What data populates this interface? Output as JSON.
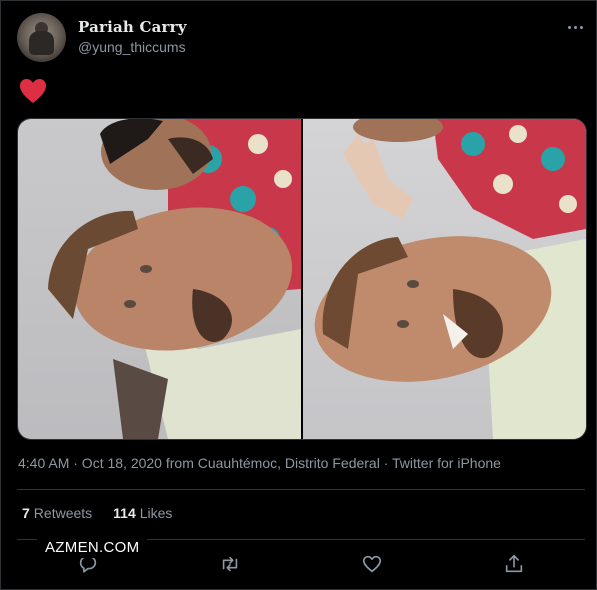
{
  "tweet": {
    "display_name": "Pariah Carry",
    "handle": "@yung_thiccums",
    "emoji": "red-heart",
    "timestamp": "4:40 AM · Oct 18, 2020 from Cuauhtémoc, Distrito Federal · Twitter for iPhone",
    "stats": {
      "retweets_count": "7",
      "retweets_label": "Retweets",
      "likes_count": "114",
      "likes_label": "Likes"
    },
    "media": [
      {
        "icon": "photo-two-men-selfie"
      },
      {
        "icon": "photo-two-men-peace-sign"
      }
    ]
  },
  "watermark": "AZMEN.COM",
  "actions": [
    "reply-icon",
    "retweet-icon",
    "like-icon",
    "share-icon"
  ],
  "colors": {
    "background": "#000000",
    "text_primary": "#e7e9ea",
    "text_secondary": "#8b98a5",
    "border": "#2f3336",
    "heart": "#e0245e"
  }
}
